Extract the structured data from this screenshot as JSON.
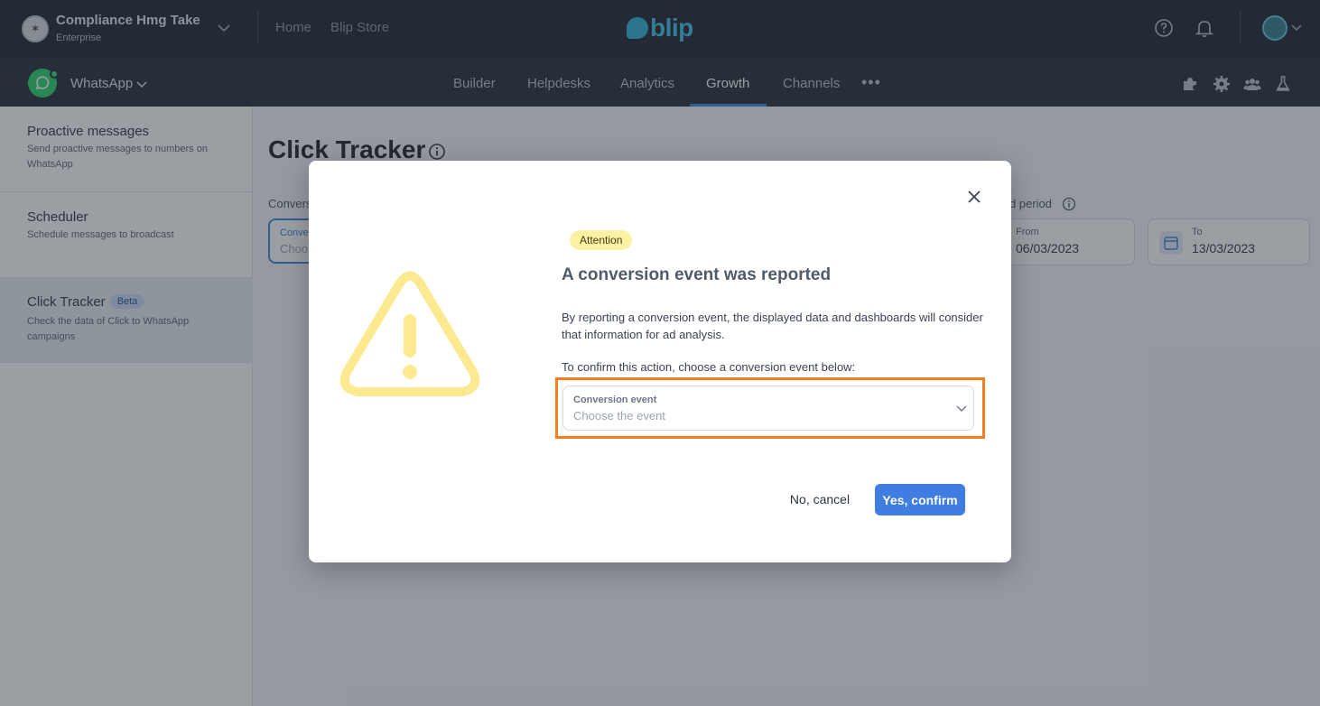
{
  "topbar": {
    "tenant_name": "Compliance Hmg Take",
    "tenant_plan": "Enterprise",
    "links": [
      "Home",
      "Blip Store"
    ],
    "logo_text": "blip"
  },
  "subnav": {
    "channel": "WhatsApp",
    "tabs": [
      "Builder",
      "Helpdesks",
      "Analytics",
      "Growth",
      "Channels"
    ],
    "active_tab": "Growth",
    "more": "•••"
  },
  "sidebar": {
    "items": [
      {
        "title": "Proactive messages",
        "description": "Send proactive messages to numbers on WhatsApp"
      },
      {
        "title": "Scheduler",
        "description": "Schedule messages to broadcast"
      },
      {
        "title": "Click Tracker",
        "badge": "Beta",
        "description": "Check the data of Click to WhatsApp campaigns"
      }
    ]
  },
  "main": {
    "title": "Click Tracker",
    "conversion_label": "Convers",
    "conversion_input_label": "Conver",
    "conversion_input_placeholder": "Choos",
    "period_label": "d period",
    "from_label": "From",
    "from_value": "06/03/2023",
    "to_label": "To",
    "to_value": "13/03/2023"
  },
  "modal": {
    "badge": "Attention",
    "title": "A conversion event was reported",
    "body": "By reporting a conversion event, the displayed data and dashboards will consider that information for ad analysis.",
    "prompt": "To confirm this action, choose a conversion event below:",
    "select_label": "Conversion event",
    "select_placeholder": "Choose the event",
    "cancel_label": "No, cancel",
    "confirm_label": "Yes, confirm"
  },
  "colors": {
    "topbar_bg": "#1a212c",
    "accent": "#3f7de0",
    "highlight": "#f47e20",
    "warning": "#fde98f"
  }
}
